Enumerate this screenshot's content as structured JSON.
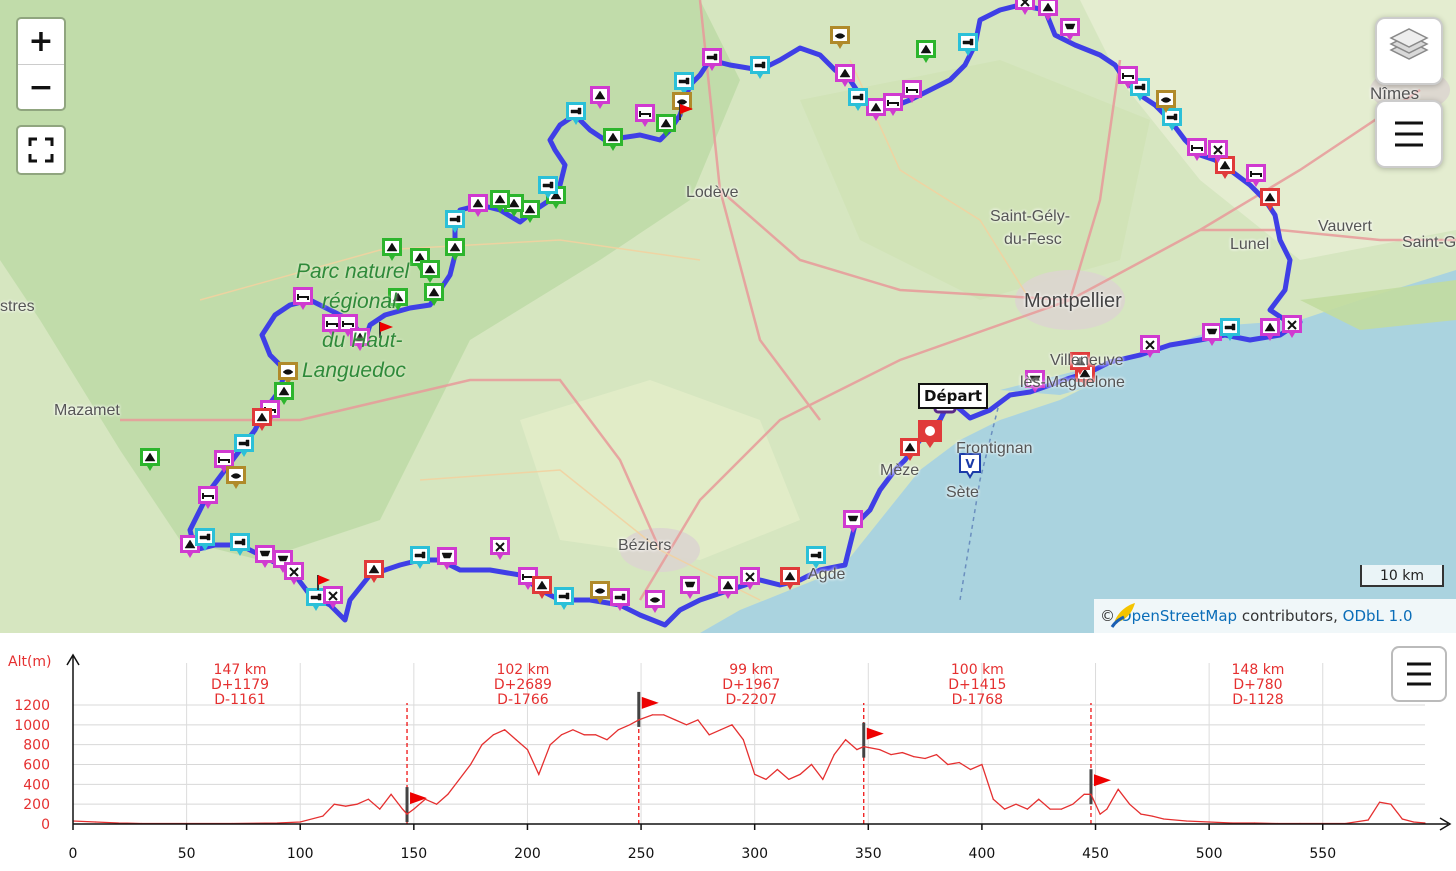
{
  "map": {
    "zoom_in": "+",
    "zoom_out": "−",
    "fullscreen_icon": "fullscreen-icon",
    "layers_icon": "layers-icon",
    "menu_icon": "hamburger-menu-icon",
    "scale_label": "10 km",
    "attribution": {
      "copyright": "©",
      "osm": "OpenStreetMap",
      "contributors": "contributors,",
      "license": "ODbL 1.0"
    },
    "places": {
      "nimes": "Nîmes",
      "lodeve": "Lodève",
      "saint_gely_1": "Saint-Gély-",
      "saint_gely_2": "du-Fesc",
      "lunel": "Lunel",
      "vauvert": "Vauvert",
      "saint_g": "Saint-G",
      "montpellier": "Montpellier",
      "villeneuve_1": "Villeneuve",
      "villeneuve_2": "lès-Maguelone",
      "frontignan": "Frontignan",
      "sete": "Sète",
      "meze": "Mèze",
      "beziers": "Béziers",
      "agde": "Agde",
      "mazamet": "Mazamet",
      "castres": "stres",
      "park_1": "Parc naturel",
      "park_2": "régional",
      "park_3": "du Haut-",
      "park_4": "Languedoc"
    },
    "start_label": "Départ",
    "colors": {
      "route": "#3f3fe6",
      "sea": "#aad3df",
      "land": "#d6e6c0",
      "forest": "#b8d7a0"
    }
  },
  "profile": {
    "y_axis_label": "Alt(m)",
    "y_ticks": [
      "1200",
      "1000",
      "800",
      "600",
      "400",
      "200",
      "0"
    ],
    "x_ticks": [
      "0",
      "50",
      "100",
      "150",
      "200",
      "250",
      "300",
      "350",
      "400",
      "450",
      "500",
      "550"
    ],
    "menu_icon": "hamburger-menu-icon",
    "stages": [
      {
        "distance": "147 km",
        "gain": "D+1179",
        "loss": "D-1161"
      },
      {
        "distance": "102 km",
        "gain": "D+2689",
        "loss": "D-1766"
      },
      {
        "distance": "99 km",
        "gain": "D+1967",
        "loss": "D-2207"
      },
      {
        "distance": "100 km",
        "gain": "D+1415",
        "loss": "D-1768"
      },
      {
        "distance": "148 km",
        "gain": "D+780",
        "loss": "D-1128"
      }
    ],
    "stage_ends_km": [
      147,
      249,
      348,
      448
    ],
    "chart_data": {
      "type": "line",
      "xlabel": "",
      "ylabel": "Alt(m)",
      "xlim": [
        0,
        595
      ],
      "ylim": [
        0,
        1300
      ],
      "x": [
        0,
        10,
        20,
        30,
        50,
        70,
        90,
        100,
        110,
        115,
        120,
        125,
        130,
        135,
        140,
        145,
        147,
        150,
        155,
        160,
        165,
        170,
        175,
        180,
        185,
        190,
        195,
        200,
        205,
        210,
        215,
        220,
        225,
        230,
        235,
        240,
        245,
        249,
        255,
        260,
        265,
        270,
        275,
        280,
        285,
        290,
        295,
        300,
        305,
        310,
        315,
        320,
        325,
        330,
        335,
        340,
        345,
        348,
        355,
        360,
        365,
        370,
        375,
        380,
        385,
        390,
        395,
        400,
        405,
        410,
        415,
        420,
        425,
        430,
        435,
        440,
        445,
        448,
        452,
        455,
        460,
        465,
        470,
        475,
        480,
        490,
        500,
        510,
        520,
        530,
        540,
        550,
        560,
        570,
        575,
        580,
        585,
        590,
        595
      ],
      "y": [
        30,
        20,
        10,
        5,
        5,
        5,
        10,
        20,
        80,
        200,
        180,
        200,
        250,
        150,
        300,
        150,
        100,
        150,
        250,
        200,
        300,
        450,
        600,
        800,
        900,
        950,
        850,
        750,
        500,
        800,
        900,
        950,
        900,
        900,
        850,
        950,
        1000,
        1050,
        1100,
        1100,
        1050,
        1000,
        1050,
        900,
        950,
        1000,
        850,
        500,
        450,
        550,
        450,
        500,
        600,
        450,
        700,
        850,
        750,
        780,
        750,
        700,
        720,
        680,
        660,
        700,
        600,
        620,
        550,
        600,
        250,
        150,
        200,
        150,
        250,
        150,
        150,
        200,
        300,
        300,
        100,
        150,
        350,
        200,
        100,
        80,
        50,
        30,
        20,
        10,
        10,
        5,
        5,
        5,
        5,
        40,
        220,
        200,
        50,
        20,
        10
      ],
      "series": [
        {
          "values_ref": "y"
        }
      ]
    }
  }
}
